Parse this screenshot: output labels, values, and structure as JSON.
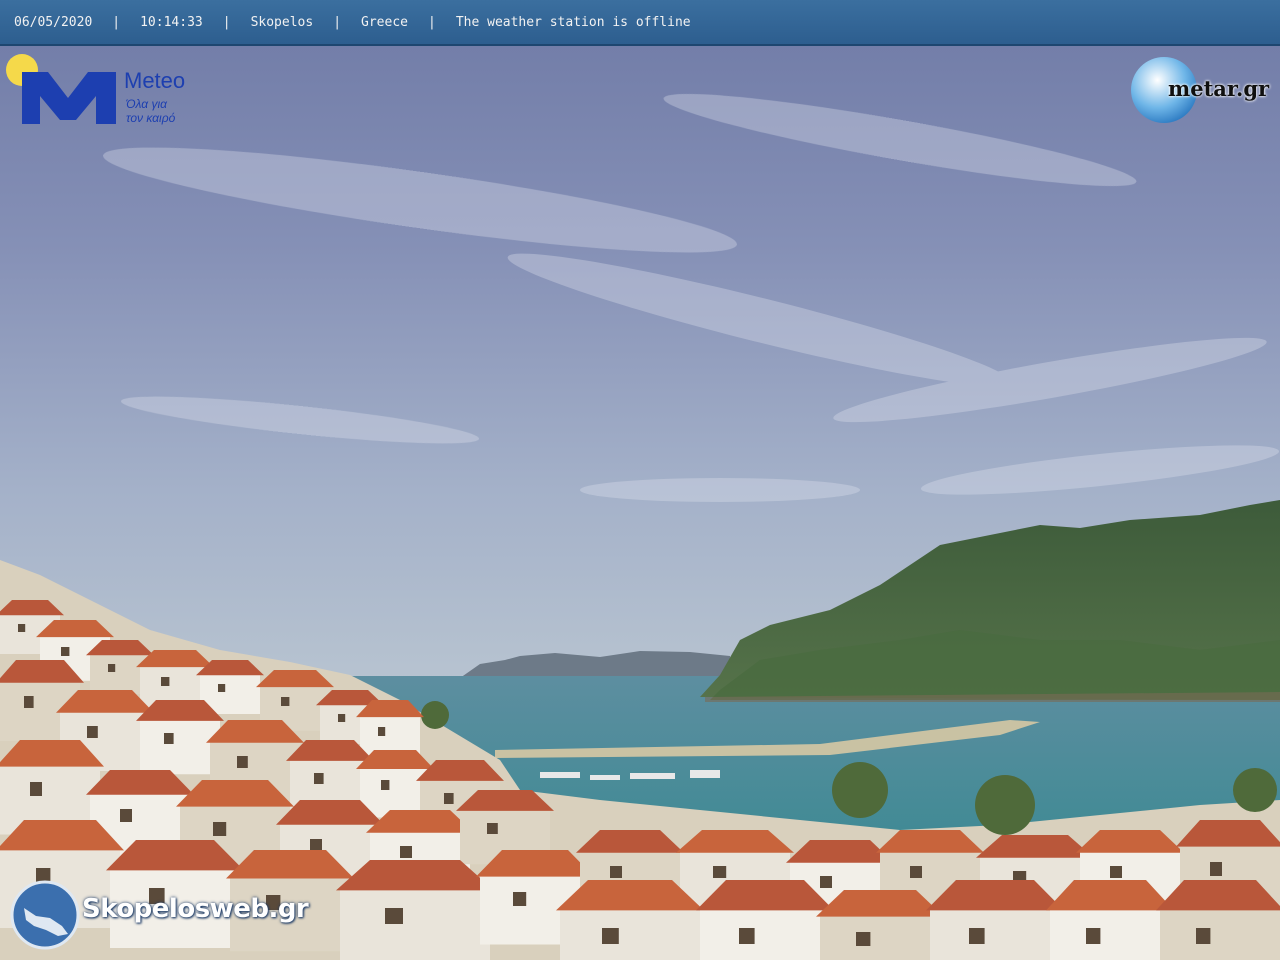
{
  "top_bar": {
    "date": "06/05/2020",
    "time": "10:14:33",
    "location": "Skopelos",
    "country": "Greece",
    "status": "The weather station is offline",
    "separator": "|"
  },
  "logos": {
    "meteo_name": "Meteo",
    "meteo_tagline_1": "Όλα για",
    "meteo_tagline_2": "τον καιρό",
    "metar_name": "metar.gr",
    "skopelos_name": "Skopelosweb.gr"
  },
  "colors": {
    "top_bar": "#2d5e8f",
    "meteo_blue": "#1d3fb0",
    "sun_yellow": "#f5d94a",
    "roof_terracotta": "#c8643c",
    "sea": "#4f8c96"
  }
}
